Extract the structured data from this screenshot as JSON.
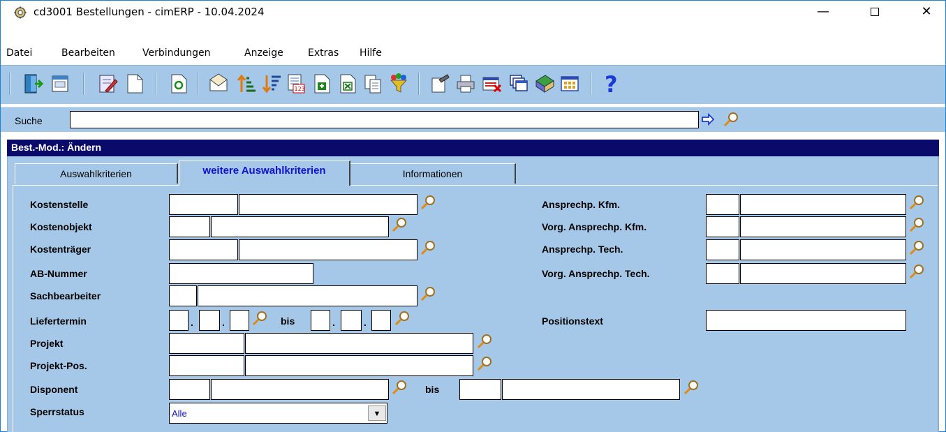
{
  "window": {
    "title": "cd3001 Bestellungen - cimERP - 10.04.2024",
    "minimize": "—",
    "close": "✕"
  },
  "menu": [
    "Datei",
    "Bearbeiten",
    "Verbindungen",
    "Anzeige",
    "Extras",
    "Hilfe"
  ],
  "toolbar_icons": [
    "exit-icon",
    "calendar-icon",
    "edit-icon",
    "new-document-icon",
    "refresh-icon",
    "mail-icon",
    "sort-ascending-icon",
    "sort-descending-icon",
    "number-format-icon",
    "export-icon",
    "excel-icon",
    "copy-icon",
    "filter-icon",
    "paste-icon",
    "print-icon",
    "delete-icon",
    "windows-icon",
    "book-icon",
    "grid-icon",
    "help-icon"
  ],
  "search": {
    "label": "Suche",
    "value": ""
  },
  "mode_title": "Best.-Mod.: Ändern",
  "tabs": [
    "Auswahlkriterien",
    "weitere Auswahlkriterien",
    "Informationen"
  ],
  "left_fields": {
    "kostenstelle": "Kostenstelle",
    "kostenobjekt": "Kostenobjekt",
    "kostentraeger": "Kostenträger",
    "ab_nummer": "AB-Nummer",
    "sachbearbeiter": "Sachbearbeiter",
    "liefertermin": "Liefertermin",
    "projekt": "Projekt",
    "projekt_pos": "Projekt-Pos.",
    "disponent": "Disponent",
    "sperrstatus": "Sperrstatus"
  },
  "bis": "bis",
  "date_separator": ".",
  "right_fields": {
    "ansprechp_kfm": "Ansprechp. Kfm.",
    "vorg_ansprechp_kfm": "Vorg. Ansprechp. Kfm.",
    "ansprechp_tech": "Ansprechp. Tech.",
    "vorg_ansprechp_tech": "Vorg. Ansprechp. Tech.",
    "positionstext": "Positionstext"
  },
  "sperrstatus_value": "Alle",
  "colors": {
    "panel": "#a6c8e8",
    "mode_bar": "#0a0a6b",
    "active_tab_text": "#1010d8"
  }
}
